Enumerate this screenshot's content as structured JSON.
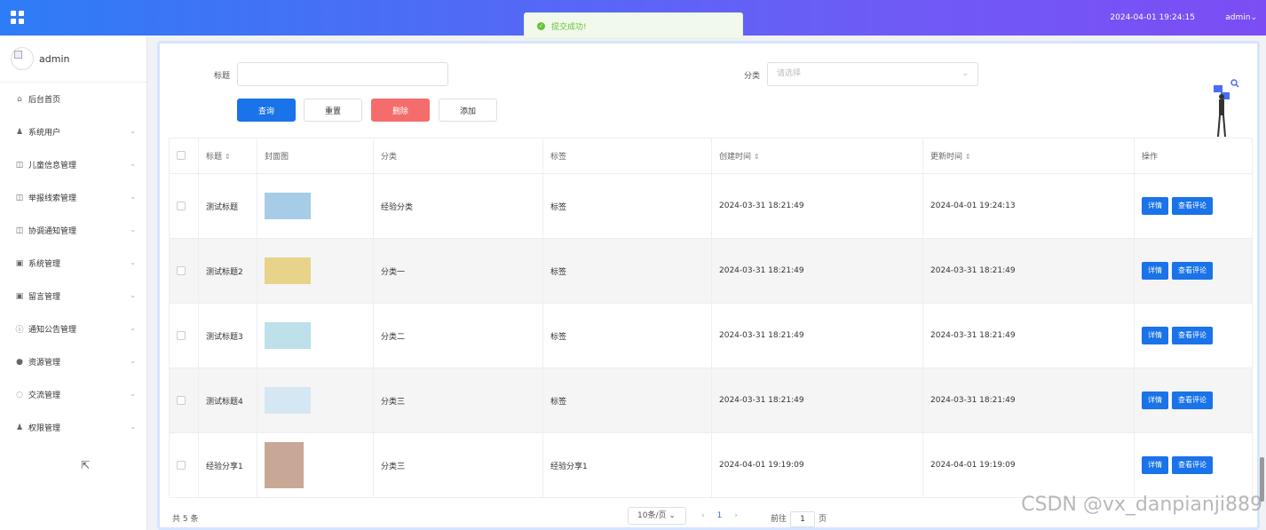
{
  "topbar": {
    "datetime": "2024-04-01 19:24:15",
    "user": "admin",
    "user_caret": "⌄"
  },
  "toast": {
    "message": "提交成功!",
    "icon": "check-circle-icon"
  },
  "sidebar": {
    "username": "admin",
    "items": [
      {
        "label": "后台首页",
        "icon": "home-icon",
        "glyph": "⌂",
        "expandable": false
      },
      {
        "label": "系统用户",
        "icon": "user-icon",
        "glyph": "♟",
        "expandable": true
      },
      {
        "label": "儿童信息管理",
        "icon": "doc-icon",
        "glyph": "◫",
        "expandable": true
      },
      {
        "label": "举报线索管理",
        "icon": "doc-icon",
        "glyph": "◫",
        "expandable": true
      },
      {
        "label": "协调通知管理",
        "icon": "doc-icon",
        "glyph": "◫",
        "expandable": true
      },
      {
        "label": "系统管理",
        "icon": "image-icon",
        "glyph": "▣",
        "expandable": true
      },
      {
        "label": "留言管理",
        "icon": "image-icon",
        "glyph": "▣",
        "expandable": true
      },
      {
        "label": "通知公告管理",
        "icon": "info-icon",
        "glyph": "ⓘ",
        "expandable": true
      },
      {
        "label": "资源管理",
        "icon": "pin-icon",
        "glyph": "●",
        "expandable": true
      },
      {
        "label": "交流管理",
        "icon": "chat-icon",
        "glyph": "◌",
        "expandable": true
      },
      {
        "label": "权限管理",
        "icon": "user-icon",
        "glyph": "♟",
        "expandable": true
      }
    ]
  },
  "search": {
    "title_label": "标题",
    "title_value": "",
    "category_label": "分类",
    "category_placeholder": "请选择"
  },
  "buttons": {
    "query": "查询",
    "reset": "重置",
    "delete": "删除",
    "add": "添加"
  },
  "table": {
    "headers": {
      "title": "标题",
      "cover": "封面图",
      "category": "分类",
      "tag": "标签",
      "created": "创建时间",
      "updated": "更新时间",
      "ops": "操作"
    },
    "sort_glyph": "⇕",
    "rows": [
      {
        "title": "测试标题",
        "category": "经验分类",
        "tag": "标签",
        "created": "2024-03-31 18:21:49",
        "updated": "2024-04-01 19:24:13",
        "thumb_color": "#a7cce8"
      },
      {
        "title": "测试标题2",
        "category": "分类一",
        "tag": "标签",
        "created": "2024-03-31 18:21:49",
        "updated": "2024-03-31 18:21:49",
        "thumb_color": "#e8d38a"
      },
      {
        "title": "测试标题3",
        "category": "分类二",
        "tag": "标签",
        "created": "2024-03-31 18:21:49",
        "updated": "2024-03-31 18:21:49",
        "thumb_color": "#bde0ea"
      },
      {
        "title": "测试标题4",
        "category": "分类三",
        "tag": "标签",
        "created": "2024-03-31 18:21:49",
        "updated": "2024-03-31 18:21:49",
        "thumb_color": "#d5e7f2"
      },
      {
        "title": "经验分享1",
        "category": "分类三",
        "tag": "经验分享1",
        "created": "2024-04-01 19:19:09",
        "updated": "2024-04-01 19:19:09",
        "thumb_color": "#c9a796"
      }
    ],
    "actions": {
      "detail": "详情",
      "comments": "查看评论"
    }
  },
  "pagination": {
    "total": "共 5 条",
    "page_size": "10条/页",
    "prev": "‹",
    "current": "1",
    "next": "›",
    "goto_label": "前往",
    "goto_value": "1",
    "goto_suffix": "页"
  },
  "watermark": "CSDN @vx_danpianji889",
  "colors": {
    "primary": "#1a73e8",
    "danger": "#f56c6c",
    "success": "#67c23a",
    "topbar_start": "#2e7cf6",
    "topbar_end": "#7c4df5"
  }
}
